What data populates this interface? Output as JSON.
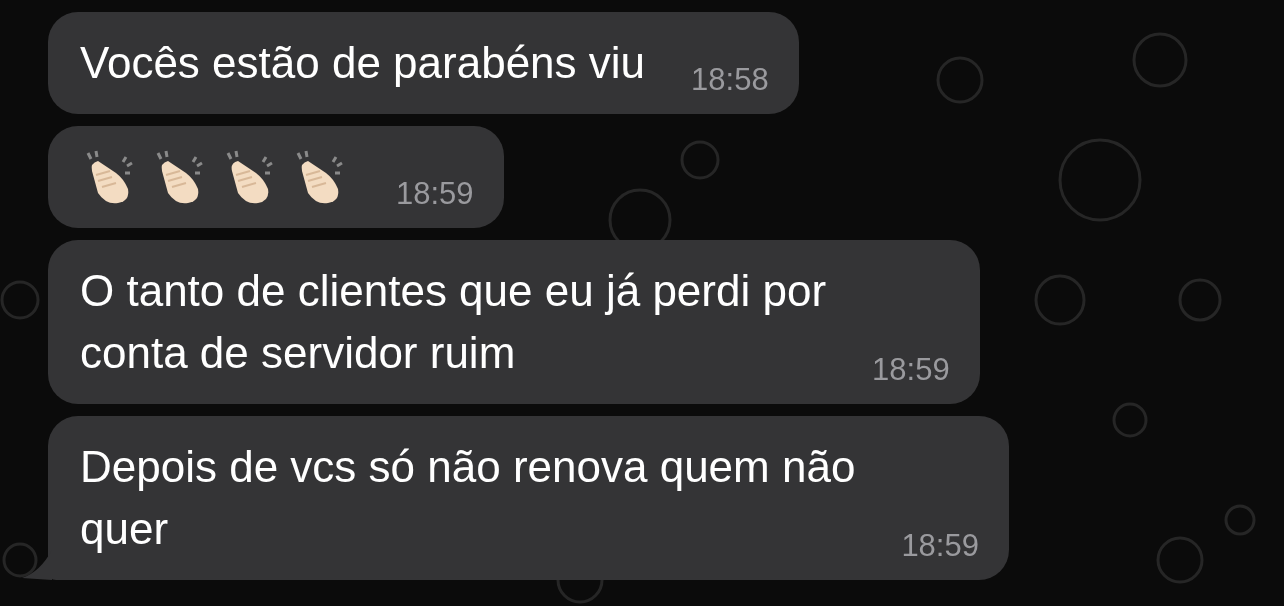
{
  "messages": [
    {
      "kind": "text",
      "text": "Vocês estão de parabéns viu",
      "time": "18:58",
      "tail": false
    },
    {
      "kind": "emoji",
      "icons": [
        {
          "kind": "clap"
        },
        {
          "kind": "clap"
        },
        {
          "kind": "clap"
        },
        {
          "kind": "clap"
        }
      ],
      "time": "18:59",
      "tail": false
    },
    {
      "kind": "text",
      "text": "O tanto de clientes que eu já perdi por\nconta de servidor ruim",
      "time": "18:59",
      "tail": false
    },
    {
      "kind": "text",
      "text": "Depois de vcs só não renova quem não\nquer",
      "time": "18:59",
      "tail": true
    }
  ]
}
